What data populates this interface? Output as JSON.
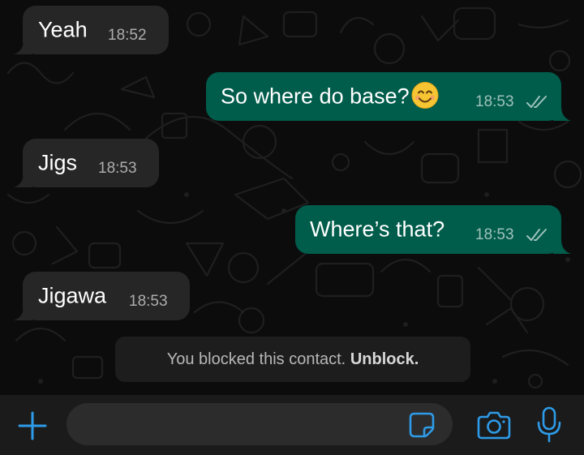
{
  "theme": {
    "incoming_bubble": "#262626",
    "outgoing_bubble": "#005c4b",
    "accent": "#2e9be8",
    "background": "#0c0c0c"
  },
  "messages": [
    {
      "direction": "incoming",
      "text": "Yeah",
      "time": "18:52"
    },
    {
      "direction": "outgoing",
      "text": "So where do base?",
      "emoji": "smiling-face-icon",
      "time": "18:53",
      "status_icon": "double-check-icon"
    },
    {
      "direction": "incoming",
      "text": "Jigs",
      "time": "18:53"
    },
    {
      "direction": "outgoing",
      "text": "Where’s that?",
      "time": "18:53",
      "status_icon": "double-check-icon"
    },
    {
      "direction": "incoming",
      "text": "Jigawa",
      "time": "18:53"
    }
  ],
  "system_notice": {
    "text": "You blocked this contact.",
    "action": "Unblock."
  },
  "composer": {
    "placeholder": "",
    "icons": [
      "plus-icon",
      "sticker-icon",
      "camera-icon",
      "microphone-icon"
    ]
  }
}
